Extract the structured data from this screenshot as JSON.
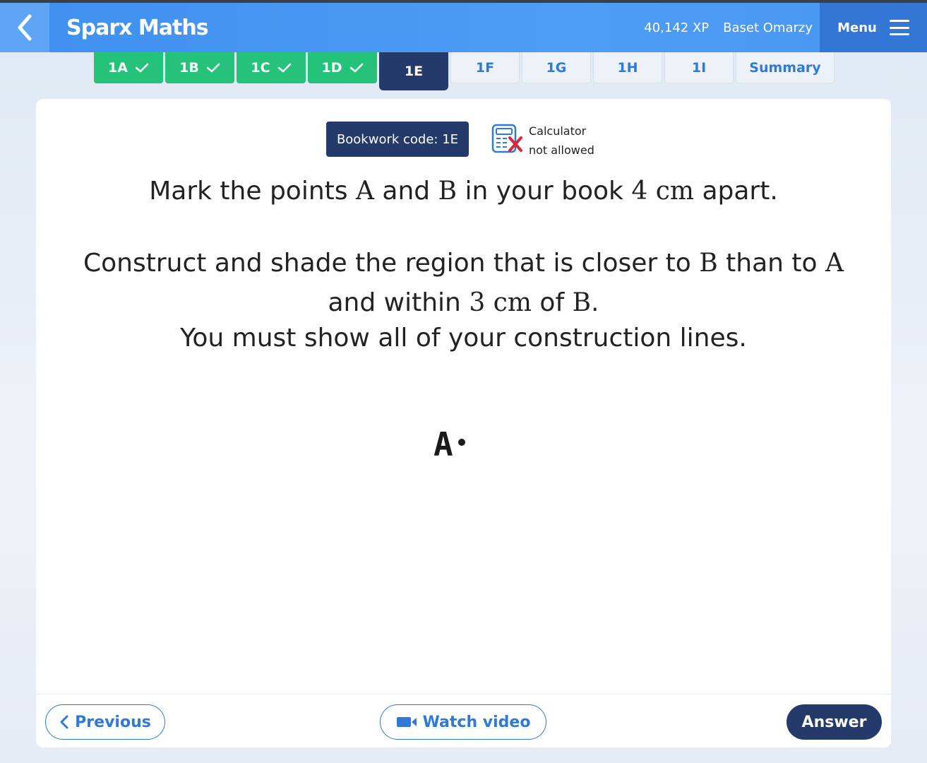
{
  "header": {
    "brand": "Sparx Maths",
    "xp": "40,142 XP",
    "user": "Baset Omarzy",
    "menu_label": "Menu"
  },
  "tabs": [
    {
      "label": "1A",
      "state": "done"
    },
    {
      "label": "1B",
      "state": "done"
    },
    {
      "label": "1C",
      "state": "done"
    },
    {
      "label": "1D",
      "state": "done"
    },
    {
      "label": "1E",
      "state": "active"
    },
    {
      "label": "1F",
      "state": "todo"
    },
    {
      "label": "1G",
      "state": "todo"
    },
    {
      "label": "1H",
      "state": "todo"
    },
    {
      "label": "1I",
      "state": "todo"
    },
    {
      "label": "Summary",
      "state": "todo"
    }
  ],
  "card": {
    "bookwork": "Bookwork code: 1E",
    "calculator_line1": "Calculator",
    "calculator_line2": "not allowed",
    "q1": {
      "t1": "Mark the points ",
      "m1": "A",
      "t2": " and ",
      "m2": "B",
      "t3": " in your book ",
      "m3": "4 cm",
      "t4": " apart."
    },
    "q2": {
      "t1": "Construct and shade the region that is closer to ",
      "m1": "B",
      "t2": " than to ",
      "m2": "A"
    },
    "q3": {
      "t1": "and within ",
      "m1": "3 cm",
      "t2": " of ",
      "m2": "B",
      "t3": "."
    },
    "q4": "You must show all of your construction lines.",
    "point_label": "A"
  },
  "footer": {
    "previous": "Previous",
    "watch_video": "Watch video",
    "answer": "Answer"
  },
  "colors": {
    "header_blue": "#4d9cf5",
    "navy": "#243a6b",
    "done_green": "#25c27a",
    "link_blue": "#2f7ad8"
  }
}
